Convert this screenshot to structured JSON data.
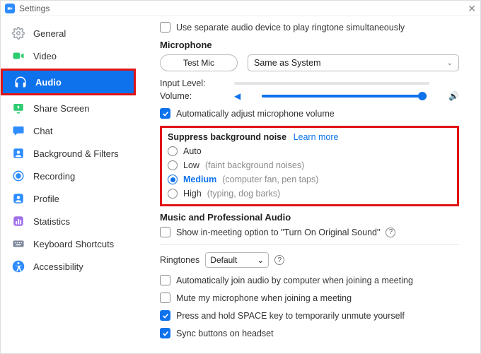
{
  "title": "Settings",
  "sidebar": {
    "items": [
      {
        "label": "General"
      },
      {
        "label": "Video"
      },
      {
        "label": "Audio"
      },
      {
        "label": "Share Screen"
      },
      {
        "label": "Chat"
      },
      {
        "label": "Background & Filters"
      },
      {
        "label": "Recording"
      },
      {
        "label": "Profile"
      },
      {
        "label": "Statistics"
      },
      {
        "label": "Keyboard Shortcuts"
      },
      {
        "label": "Accessibility"
      }
    ]
  },
  "content": {
    "separate_device": "Use separate audio device to play ringtone simultaneously",
    "microphone_heading": "Microphone",
    "test_mic": "Test Mic",
    "mic_selected": "Same as System",
    "input_level": "Input Level:",
    "volume": "Volume:",
    "auto_adjust": "Automatically adjust microphone volume",
    "suppress_heading": "Suppress background noise",
    "learn_more": "Learn more",
    "noise": {
      "auto": "Auto",
      "low": "Low",
      "low_hint": "(faint background noises)",
      "medium": "Medium",
      "medium_hint": "(computer fan, pen taps)",
      "high": "High",
      "high_hint": "(typing, dog barks)"
    },
    "music_heading": "Music and Professional Audio",
    "original_sound": "Show in-meeting option to \"Turn On Original Sound\"",
    "ringtones_label": "Ringtones",
    "ringtones_value": "Default",
    "auto_join": "Automatically join audio by computer when joining a meeting",
    "mute_mic": "Mute my microphone when joining a meeting",
    "space_unmute": "Press and hold SPACE key to temporarily unmute yourself",
    "sync_headset": "Sync buttons on headset"
  }
}
